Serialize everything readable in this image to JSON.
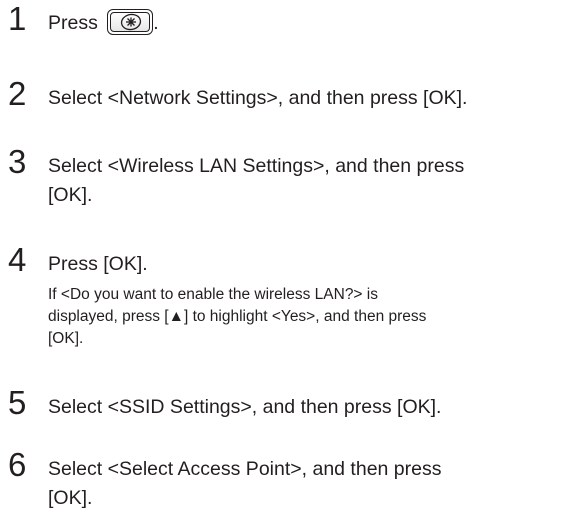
{
  "steps": [
    {
      "number": "1",
      "text_before": "Press",
      "icon": "menu-key-icon",
      "text_after": "."
    },
    {
      "number": "2",
      "text": "Select <Network Settings>, and then press [OK]."
    },
    {
      "number": "3",
      "line1": "Select <Wireless LAN Settings>, and then press",
      "line2": "[OK]."
    },
    {
      "number": "4",
      "text": "Press [OK].",
      "note_line1": "If <Do you want to enable the wireless LAN?> is",
      "note_line2": "displayed, press [▲] to highlight <Yes>, and then press",
      "note_line3": "[OK]."
    },
    {
      "number": "5",
      "text": "Select <SSID Settings>, and then press [OK]."
    },
    {
      "number": "6",
      "line1": "Select <Select Access Point>, and then press",
      "line2": "[OK]."
    }
  ]
}
